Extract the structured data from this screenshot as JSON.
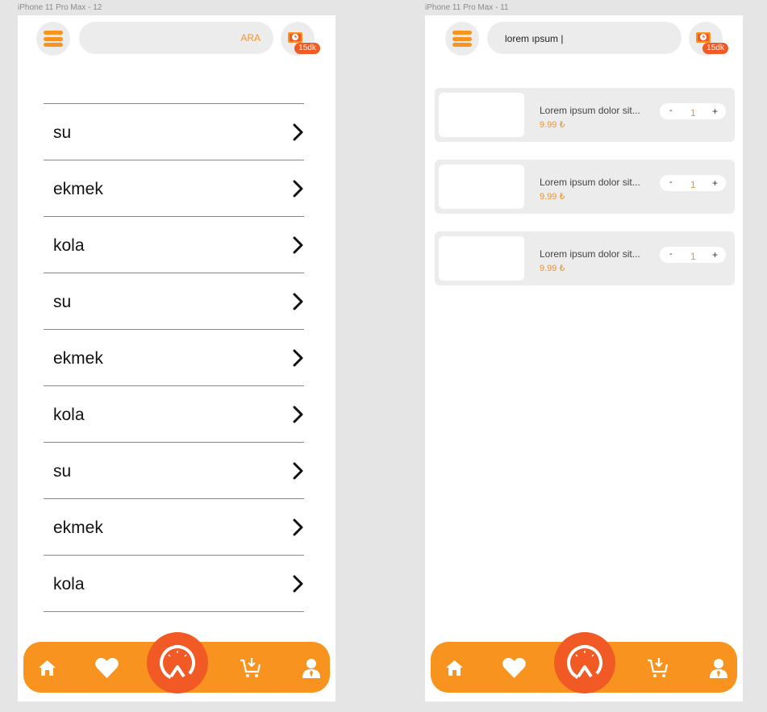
{
  "left_frame": {
    "label": "iPhone 11 Pro Max - 12",
    "header": {
      "menu_icon": "hamburger-icon",
      "search_button_label": "ARA",
      "search_value": "",
      "time_icon": "delivery-clock-icon",
      "time_badge": "15dk"
    },
    "list_items": [
      "su",
      "ekmek",
      "kola",
      "su",
      "ekmek",
      "kola",
      "su",
      "ekmek",
      "kola"
    ],
    "navbar": {
      "items": [
        "home-icon",
        "heart-icon",
        "speedometer-icon",
        "cart-download-icon",
        "user-icon"
      ],
      "color": "#f7931e",
      "center_color": "#f15a24"
    }
  },
  "right_frame": {
    "label": "iPhone 11 Pro Max - 11",
    "header": {
      "menu_icon": "hamburger-icon",
      "search_value": "lorem ıpsum |",
      "time_icon": "delivery-clock-icon",
      "time_badge": "15dk"
    },
    "cart_items": [
      {
        "name": "Lorem ipsum dolor sit...",
        "price": "9.99 ₺",
        "minus": "-",
        "quantity": "1",
        "plus": "+"
      },
      {
        "name": "Lorem ipsum dolor sit...",
        "price": "9.99 ₺",
        "minus": "-",
        "quantity": "1",
        "plus": "+"
      },
      {
        "name": "Lorem ipsum dolor sit...",
        "price": "9.99 ₺",
        "minus": "-",
        "quantity": "1",
        "plus": "+"
      }
    ],
    "navbar": {
      "items": [
        "home-icon",
        "heart-icon",
        "speedometer-icon",
        "cart-download-icon",
        "user-icon"
      ]
    }
  },
  "colors": {
    "accent": "#f7931e",
    "accent_dark": "#f15a24",
    "surface": "#ececec",
    "canvas": "#e5e5e5"
  }
}
